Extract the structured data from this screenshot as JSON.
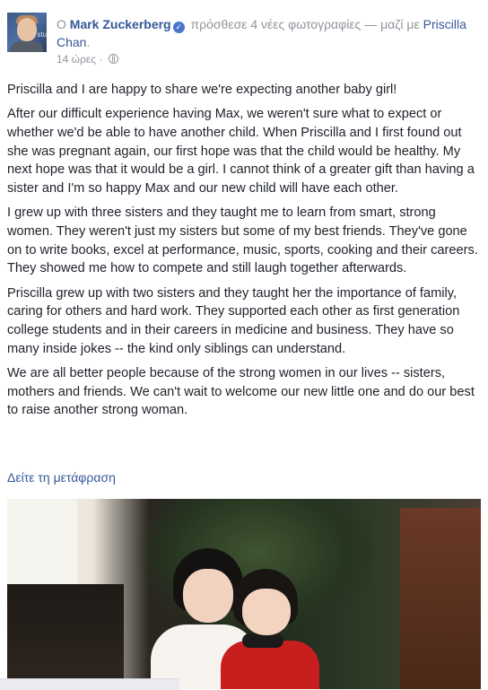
{
  "post": {
    "title_prefix": "Ο ",
    "author": "Mark Zuckerberg",
    "verified_mark": "✓",
    "action": " πρόσθεσε 4 νέες φωτογραφίες — μαζί με ",
    "tagged": "Priscilla Chan",
    "title_suffix": ".",
    "timestamp": "14 ώρες ·",
    "avatar_label": "stu",
    "paragraphs": [
      "Priscilla and I are happy to share we're expecting another baby girl!",
      "After our difficult experience having Max, we weren't sure what to expect or whether we'd be able to have another child. When Priscilla and I first found out she was pregnant again, our first hope was that the child would be healthy. My next hope was that it would be a girl. I cannot think of a greater gift than having a sister and I'm so happy Max and our new child will have each other.",
      "I grew up with three sisters and they taught me to learn from smart, strong women. They weren't just my sisters but some of my best friends. They've gone on to write books, excel at performance, music, sports, cooking and their careers. They showed me how to compete and still laugh together afterwards.",
      "Priscilla grew up with two sisters and they taught her the importance of family, caring for others and hard work. They supported each other as first generation college students and in their careers in medicine and business. They have so many inside jokes -- the kind only siblings can understand.",
      "We are all better people because of the strong women in our lives -- sisters, mothers and friends. We can't wait to welcome our new little one and do our best to raise another strong woman."
    ],
    "see_translation": "Δείτε τη μετάφραση"
  },
  "colors": {
    "link": "#365899",
    "meta": "#90949c",
    "text": "#1d2129"
  }
}
